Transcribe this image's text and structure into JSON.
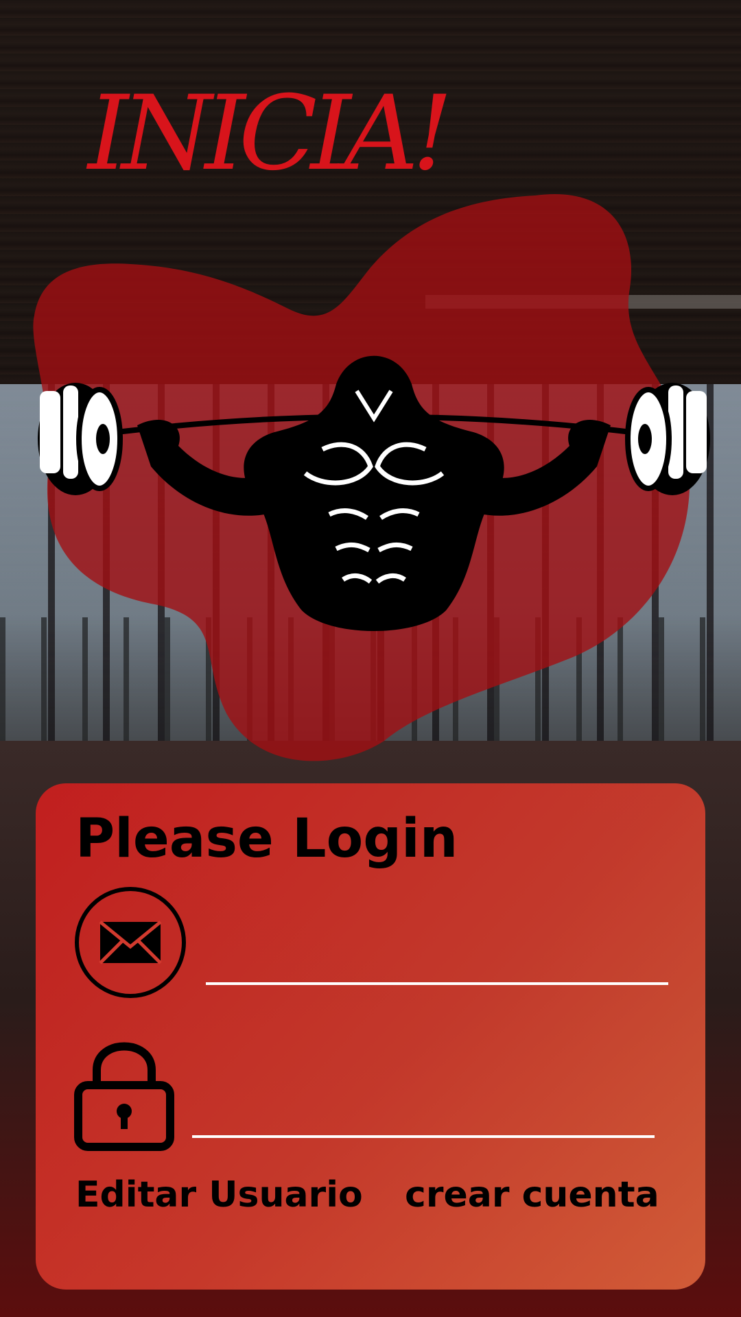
{
  "header": {
    "title": "INICIA!"
  },
  "colors": {
    "accent": "#d8141b",
    "blob": "#a30f13",
    "card_start": "#cd1e1e",
    "card_end": "#de643c"
  },
  "logo": {
    "icon": "bodybuilder-barbell-icon"
  },
  "login": {
    "title": "Please Login",
    "email_icon": "envelope-icon",
    "email_value": "",
    "password_icon": "lock-icon",
    "password_value": "",
    "edit_user_label": "Editar Usuario",
    "create_account_label": "crear cuenta"
  }
}
